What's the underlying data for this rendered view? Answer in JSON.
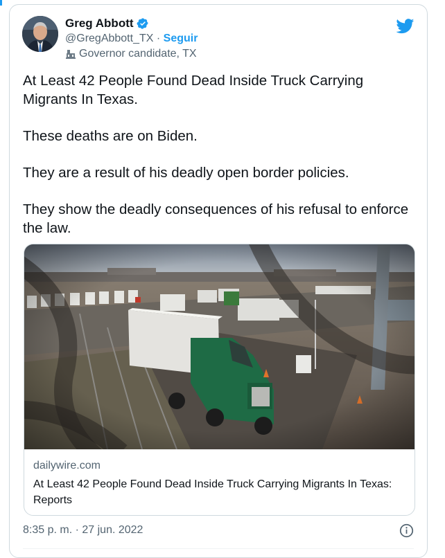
{
  "colors": {
    "accent": "#1d9bf0",
    "text_primary": "#0f1419",
    "text_secondary": "#536471",
    "border": "#cfd9de"
  },
  "author": {
    "name": "Greg Abbott",
    "handle": "@GregAbbott_TX",
    "separator": " · ",
    "follow_label": "Seguir",
    "verified_icon": "verified-badge-icon",
    "label_icon": "government-building-icon",
    "label": "Governor candidate, TX"
  },
  "tweet": {
    "paragraphs": [
      "At Least 42 People Found Dead Inside Truck Carrying Migrants In Texas.",
      "These deaths are on Biden.",
      "They are a result of his deadly open border policies.",
      "They show the deadly consequences of his refusal to enforce the law."
    ]
  },
  "link_card": {
    "domain": "dailywire.com",
    "title": "At Least 42 People Found Dead Inside Truck Carrying Migrants In Texas: Reports",
    "image_description_icon": "green-semi-truck-photo"
  },
  "footer": {
    "timestamp": "8:35 p. m. · 27 jun. 2022",
    "info_icon": "info-icon"
  },
  "brand_icon": "twitter-bird-icon"
}
